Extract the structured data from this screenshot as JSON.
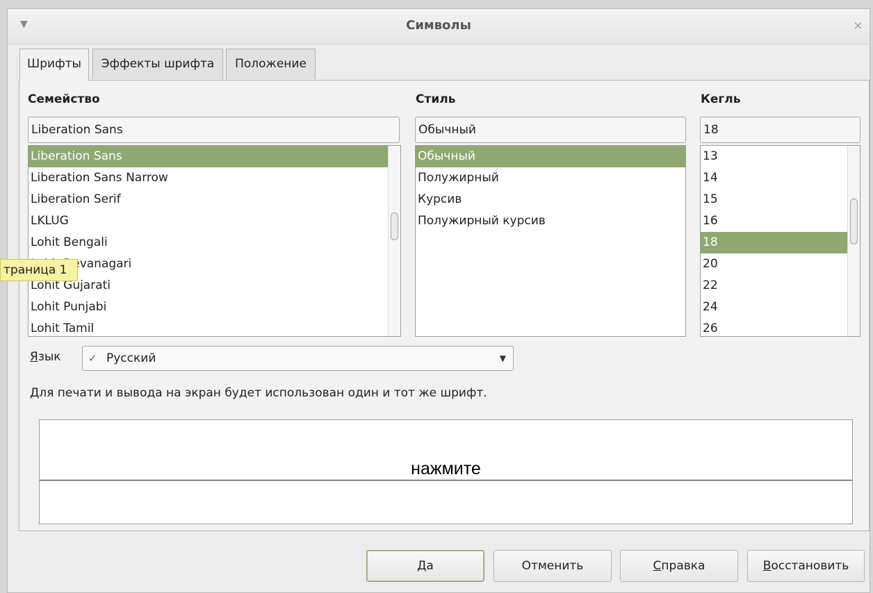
{
  "window": {
    "title": "Символы"
  },
  "tabs": [
    {
      "label": "Шрифты",
      "active": true
    },
    {
      "label": "Эффекты шрифта",
      "active": false
    },
    {
      "label": "Положение",
      "active": false
    }
  ],
  "family": {
    "header": "Семейство",
    "value": "Liberation Sans",
    "items": [
      "Liberation Sans",
      "Liberation Sans Narrow",
      "Liberation Serif",
      "LKLUG",
      "Lohit Bengali",
      "Lohit Devanagari",
      "Lohit Gujarati",
      "Lohit Punjabi",
      "Lohit Tamil"
    ],
    "selected": "Liberation Sans"
  },
  "style": {
    "header": "Стиль",
    "value": "Обычный",
    "items": [
      "Обычный",
      "Полужирный",
      "Курсив",
      "Полужирный курсив"
    ],
    "selected": "Обычный"
  },
  "size": {
    "header": "Кегль",
    "value": "18",
    "items": [
      "13",
      "14",
      "15",
      "16",
      "18",
      "20",
      "22",
      "24",
      "26"
    ],
    "selected": "18"
  },
  "language": {
    "label_prefix": "Я",
    "label_rest": "зык",
    "value": "Русский",
    "icon": "spellcheck-icon"
  },
  "info_text": "Для печати и вывода на экран будет использован один и тот же шрифт.",
  "preview_text": "нажмите",
  "tooltip": "траница 1",
  "buttons": {
    "ok": "Да",
    "cancel": "Отменить",
    "help_prefix": "С",
    "help_rest": "правка",
    "reset_prefix": "В",
    "reset_rest": "осстановить"
  },
  "colors": {
    "selection": "#8fa870",
    "tooltip": "#f8f2a4"
  }
}
